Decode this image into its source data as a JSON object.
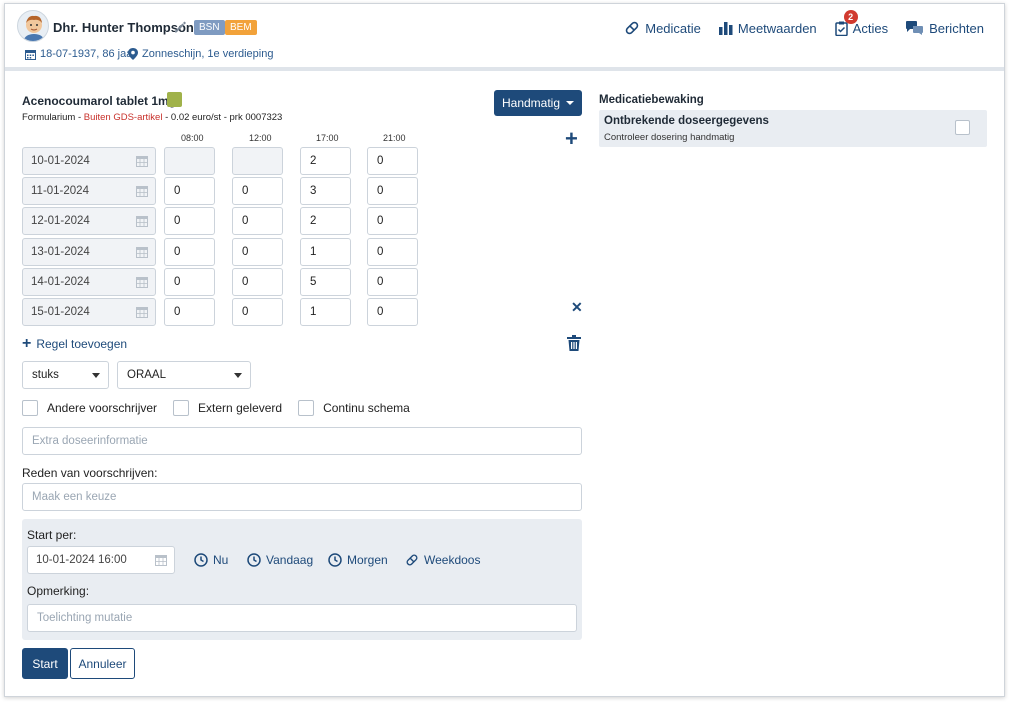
{
  "patient": {
    "name": "Dhr. Hunter Thompson",
    "badge_bsn": "BSN",
    "badge_bem": "BEM",
    "dob_age": "18-07-1937, 86 jaar",
    "location": "Zonneschijn, 1e verdieping"
  },
  "nav": {
    "medicatie": "Medicatie",
    "meetwaarden": "Meetwaarden",
    "acties": "Acties",
    "acties_count": "2",
    "berichten": "Berichten"
  },
  "drug": {
    "name": "Acenocoumarol tablet 1mg",
    "formularium": "Formularium",
    "gds": "Buiten GDS-artikel",
    "price": "0.02 euro/st",
    "prk": "prk 0007323"
  },
  "mode_button": "Handmatig",
  "times": [
    "08:00",
    "12:00",
    "17:00",
    "21:00"
  ],
  "schedule": [
    {
      "date": "10-01-2024",
      "doses": [
        "",
        "",
        "2",
        "0"
      ]
    },
    {
      "date": "11-01-2024",
      "doses": [
        "0",
        "0",
        "3",
        "0"
      ]
    },
    {
      "date": "12-01-2024",
      "doses": [
        "0",
        "0",
        "2",
        "0"
      ]
    },
    {
      "date": "13-01-2024",
      "doses": [
        "0",
        "0",
        "1",
        "0"
      ]
    },
    {
      "date": "14-01-2024",
      "doses": [
        "0",
        "0",
        "5",
        "0"
      ]
    },
    {
      "date": "15-01-2024",
      "doses": [
        "0",
        "0",
        "1",
        "0"
      ]
    }
  ],
  "add_rule": "Regel toevoegen",
  "unit_select": "stuks",
  "route_select": "ORAAL",
  "checkboxes": {
    "andere": "Andere voorschrijver",
    "extern": "Extern geleverd",
    "continu": "Continu schema"
  },
  "extra_info_placeholder": "Extra doseerinformatie",
  "reason_label": "Reden van voorschrijven:",
  "reason_placeholder": "Maak een keuze",
  "start": {
    "label": "Start per:",
    "datetime": "10-01-2024 16:00",
    "nu": "Nu",
    "vandaag": "Vandaag",
    "morgen": "Morgen",
    "weekdoos": "Weekdoos",
    "remark_label": "Opmerking:",
    "remark_placeholder": "Toelichting mutatie"
  },
  "buttons": {
    "start": "Start",
    "cancel": "Annuleer"
  },
  "monitoring": {
    "title": "Medicatiebewaking",
    "alert_title": "Ontbrekende doseergegevens",
    "alert_sub": "Controleer dosering handmatig"
  },
  "colors": {
    "primary": "#1e4a7a",
    "warning_red": "#c8312b",
    "badge_bsn": "#7f9bc1",
    "badge_bem": "#f2a23a"
  }
}
